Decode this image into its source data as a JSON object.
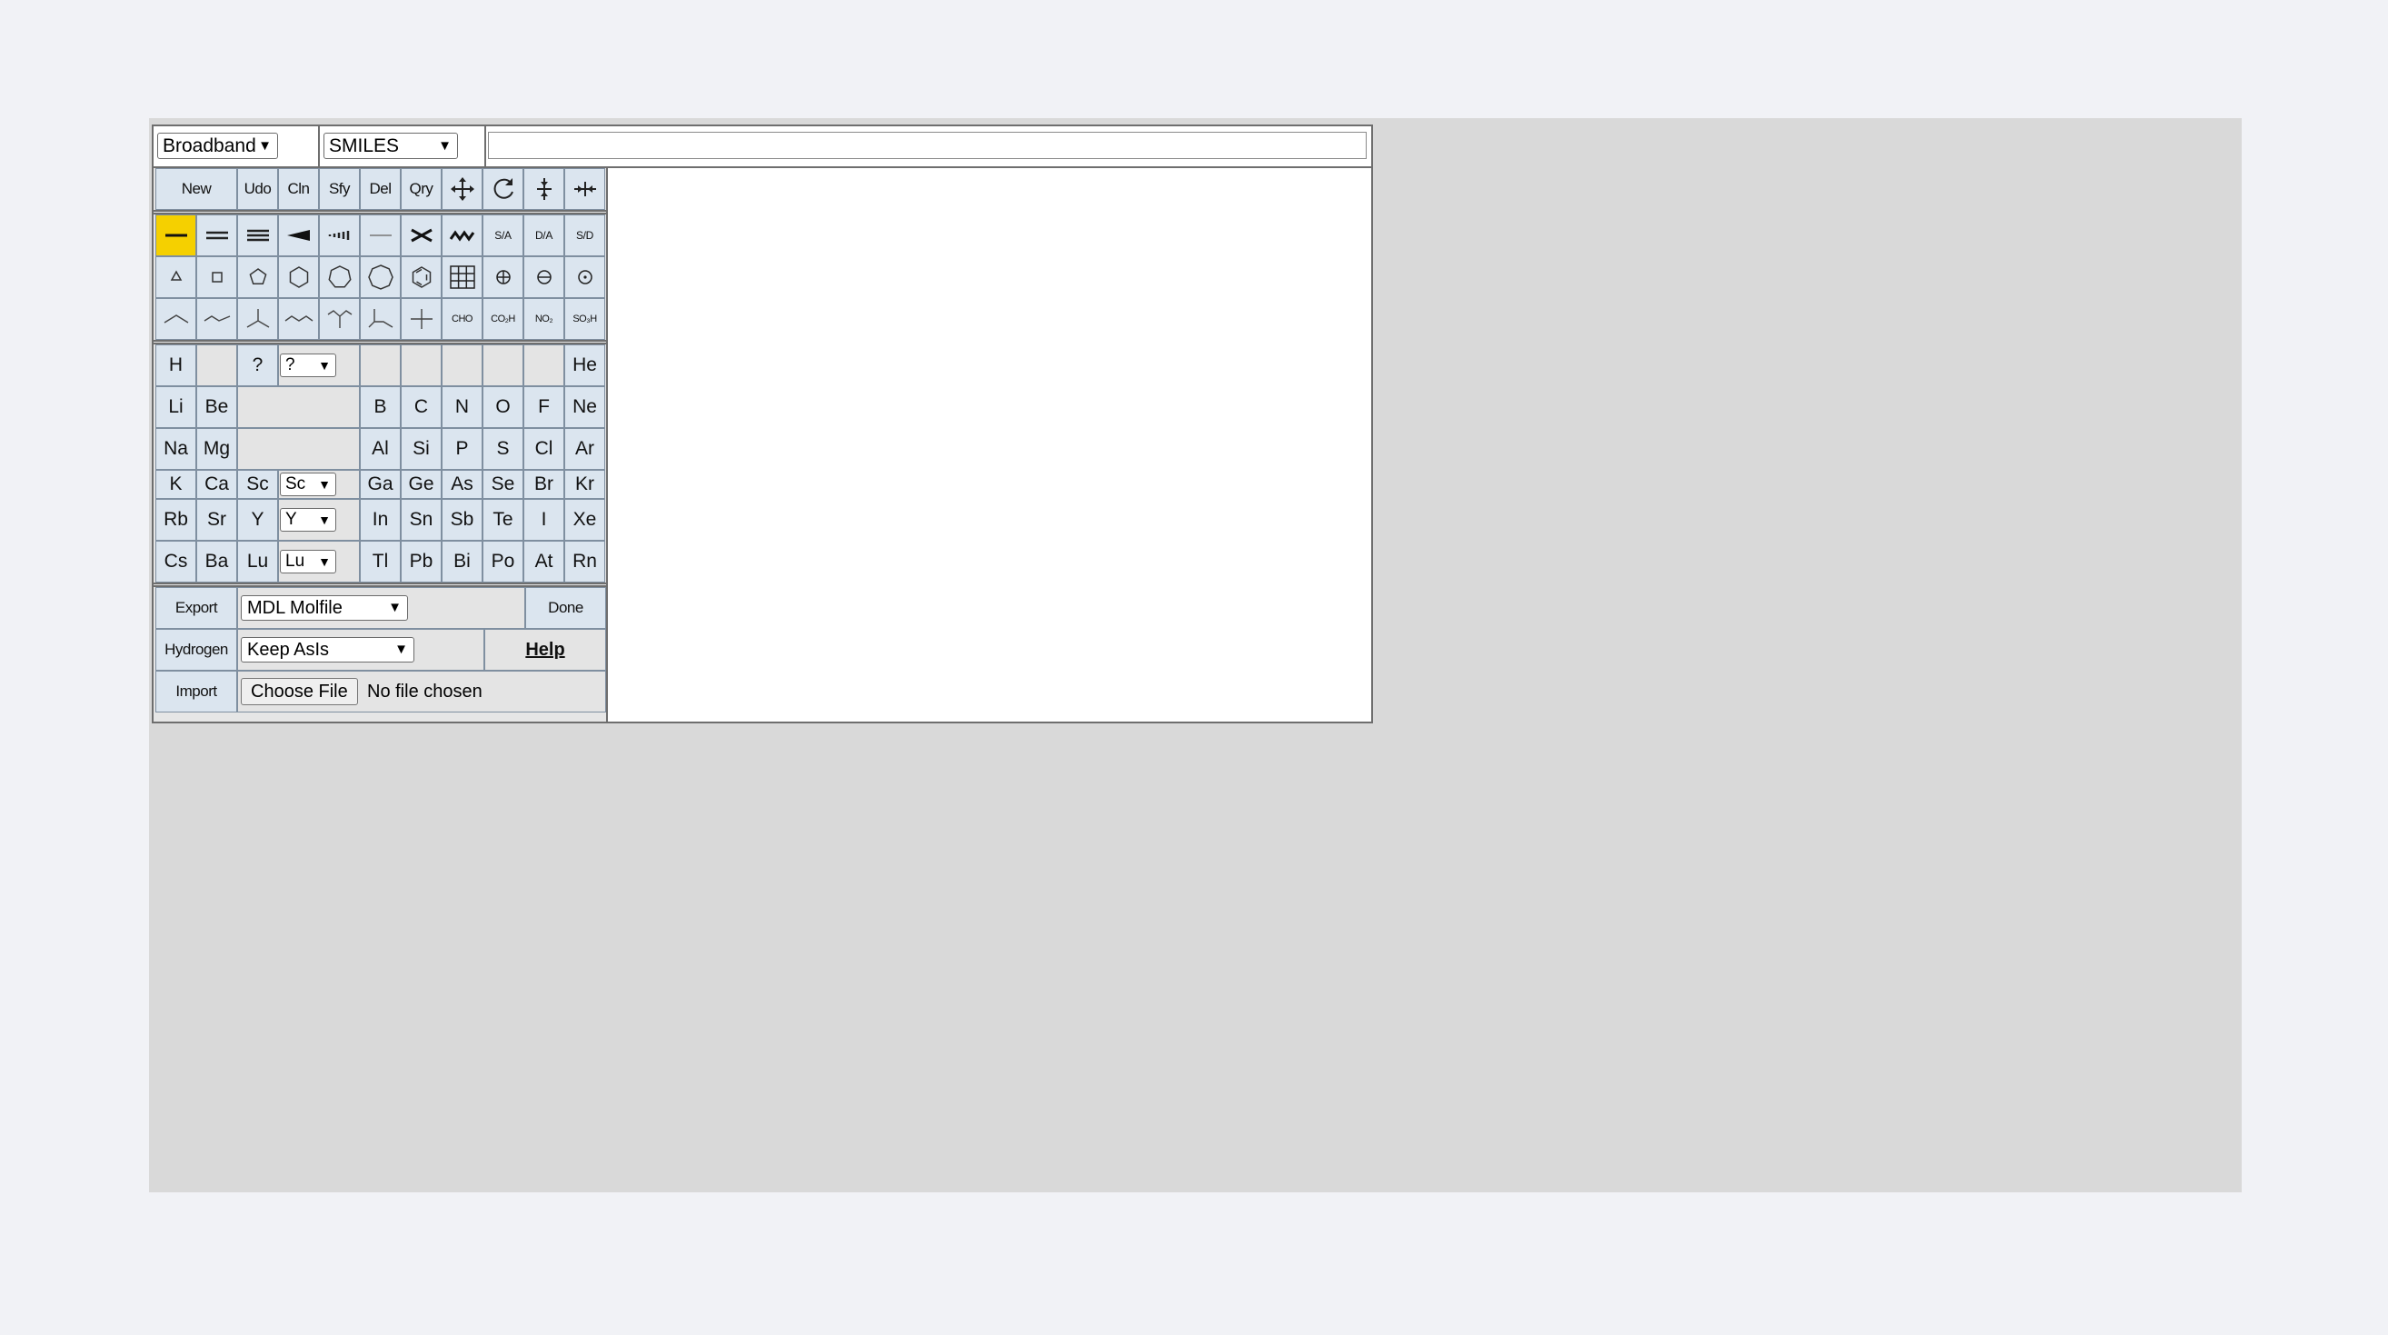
{
  "header": {
    "mode_select": "Broadband",
    "format_select": "SMILES",
    "smiles_value": ""
  },
  "tools": {
    "row1": [
      "New",
      "Udo",
      "Cln",
      "Sfy",
      "Del",
      "Qry"
    ],
    "row1_icons": [
      "move-icon",
      "rotate-icon",
      "flip-vertical-icon",
      "flip-horizontal-icon"
    ],
    "bond_icons": [
      "single-bond-icon",
      "double-bond-icon",
      "triple-bond-icon",
      "wedge-bond-icon",
      "hash-bond-icon",
      "plain-line-icon",
      "cut-bond-icon",
      "wavy-bond-icon"
    ],
    "bond_labels": [
      "S/A",
      "D/A",
      "S/D"
    ],
    "ring_icons": [
      "triangle-ring-icon",
      "square-ring-icon",
      "pentagon-ring-icon",
      "hexagon-ring-icon",
      "heptagon-ring-icon",
      "octagon-ring-icon",
      "benzene-ring-icon",
      "grid-icon",
      "positive-charge-icon",
      "negative-charge-icon",
      "radical-icon"
    ],
    "chain_icons": [
      "chain-2-icon",
      "chain-3-icon",
      "branch-3-icon",
      "chain-4-icon",
      "branch-y-icon",
      "branch-t-icon",
      "cross-icon"
    ],
    "groups": [
      "CHO",
      "CO₂H",
      "NO₂",
      "SO₃H"
    ]
  },
  "periodic": {
    "row1": {
      "left": [
        "H",
        "",
        "?"
      ],
      "select": "?",
      "right": [
        "",
        "",
        "",
        "",
        "",
        "He"
      ]
    },
    "row2": {
      "left": [
        "Li",
        "Be"
      ],
      "right": [
        "B",
        "C",
        "N",
        "O",
        "F",
        "Ne"
      ]
    },
    "row3": {
      "left": [
        "Na",
        "Mg"
      ],
      "right": [
        "Al",
        "Si",
        "P",
        "S",
        "Cl",
        "Ar"
      ]
    },
    "row4": {
      "left": [
        "K",
        "Ca",
        "Sc"
      ],
      "select": "Sc",
      "right": [
        "Ga",
        "Ge",
        "As",
        "Se",
        "Br",
        "Kr"
      ]
    },
    "row5": {
      "left": [
        "Rb",
        "Sr",
        "Y"
      ],
      "select": "Y",
      "right": [
        "In",
        "Sn",
        "Sb",
        "Te",
        "I",
        "Xe"
      ]
    },
    "row6": {
      "left": [
        "Cs",
        "Ba",
        "Lu"
      ],
      "select": "Lu",
      "right": [
        "Tl",
        "Pb",
        "Bi",
        "Po",
        "At",
        "Rn"
      ]
    }
  },
  "bottom": {
    "export_label": "Export",
    "export_format": "MDL Molfile",
    "done_label": "Done",
    "hydrogen_label": "Hydrogen",
    "hydrogen_option": "Keep AsIs",
    "help_label": "Help",
    "import_label": "Import",
    "choose_file_label": "Choose File",
    "file_status": "No file chosen"
  },
  "colors": {
    "page_bg": "#f1f2f6",
    "stage_bg": "#d9d9d9",
    "cell_bg": "#dbe5ef",
    "active_bond": "#f5d000"
  }
}
